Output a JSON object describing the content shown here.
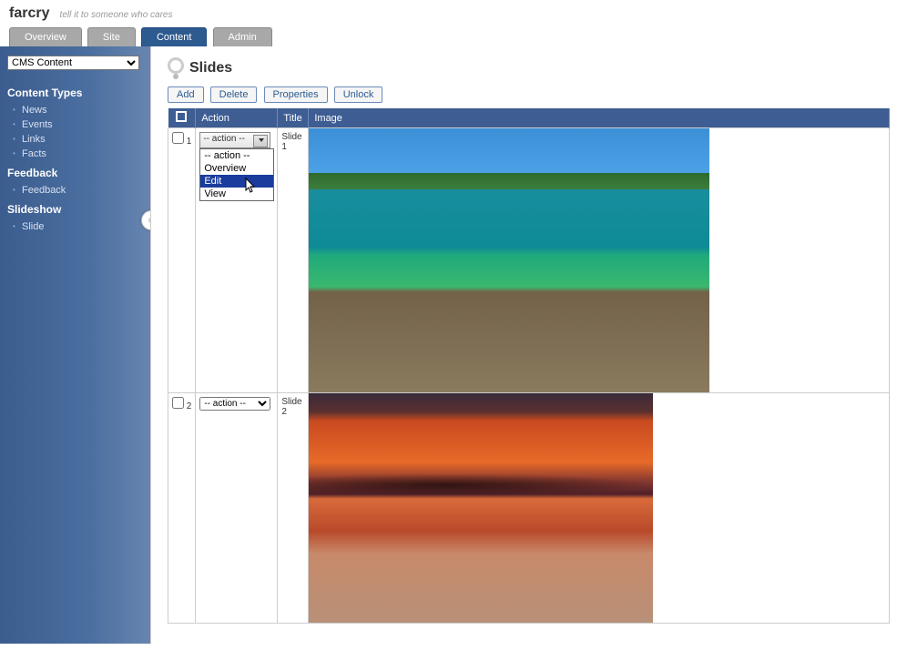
{
  "header": {
    "brand": "farcry",
    "tagline": "tell it to someone who cares"
  },
  "topnav": {
    "tabs": [
      "Overview",
      "Site",
      "Content",
      "Admin"
    ],
    "active_index": 2
  },
  "sidebar": {
    "selector_value": "CMS Content",
    "sections": [
      {
        "title": "Content Types",
        "items": [
          "News",
          "Events",
          "Links",
          "Facts"
        ]
      },
      {
        "title": "Feedback",
        "items": [
          "Feedback"
        ]
      },
      {
        "title": "Slideshow",
        "items": [
          "Slide"
        ]
      }
    ]
  },
  "page": {
    "title": "Slides"
  },
  "toolbar": {
    "add": "Add",
    "delete": "Delete",
    "properties": "Properties",
    "unlock": "Unlock"
  },
  "grid": {
    "columns": {
      "action": "Action",
      "title": "Title",
      "image": "Image"
    },
    "rows": [
      {
        "num": "1",
        "action_value": "-- action --",
        "title": "Slide 1",
        "image": "slide-1"
      },
      {
        "num": "2",
        "action_value": "-- action --",
        "title": "Slide 2",
        "image": "slide-2"
      }
    ]
  },
  "action_dropdown": {
    "open_row_index": 0,
    "options": [
      "-- action --",
      "Overview",
      "Edit",
      "View"
    ],
    "highlighted_index": 2
  }
}
